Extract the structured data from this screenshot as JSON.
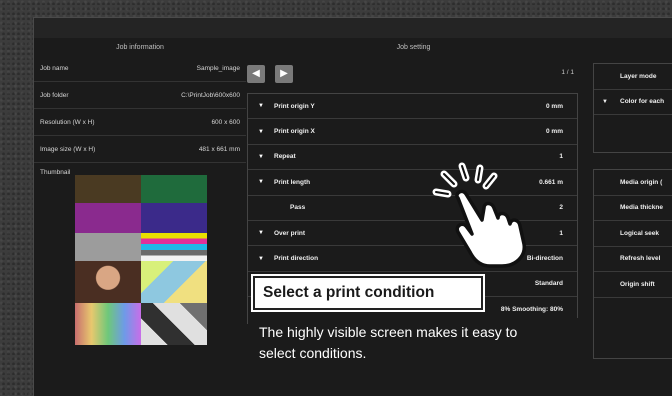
{
  "job_information": {
    "title": "Job information",
    "rows": [
      {
        "label": "Job name",
        "value": "Sample_image"
      },
      {
        "label": "Job folder",
        "value": "C:\\PrintJob\\600x600"
      },
      {
        "label": "Resolution (W x H)",
        "value": "600 x 600"
      },
      {
        "label": "Image size (W x H)",
        "value": "481 x 661 mm"
      }
    ],
    "thumbnail_label": "Thumbnail"
  },
  "job_setting": {
    "title": "Job setting",
    "prev_icon": "chevron-left-icon",
    "next_icon": "chevron-right-icon",
    "page_indicator": "1 / 1",
    "rows": [
      {
        "name": "Print origin Y",
        "value": "0 mm",
        "expandable": true
      },
      {
        "name": "Print origin X",
        "value": "0 mm",
        "expandable": true
      },
      {
        "name": "Repeat",
        "value": "1",
        "expandable": true
      },
      {
        "name": "Print length",
        "value": "0.661 m",
        "expandable": true
      },
      {
        "name": "Pass",
        "value": "2",
        "expandable": false
      },
      {
        "name": "Over print",
        "value": "1",
        "expandable": true
      },
      {
        "name": "Print direction",
        "value": "Bi-direction",
        "expandable": true
      },
      {
        "name": "",
        "value": "Standard",
        "expandable": false
      },
      {
        "name": "",
        "value": "8% Smoothing: 80%",
        "expandable": false
      }
    ]
  },
  "right_panel": {
    "group1": [
      {
        "name": "Layer mode",
        "expandable": false
      },
      {
        "name": "Color for each",
        "expandable": true
      }
    ],
    "group2": [
      {
        "name": "Media origin (",
        "expandable": false
      },
      {
        "name": "Media thickne",
        "expandable": false
      },
      {
        "name": "Logical seek",
        "expandable": false
      },
      {
        "name": "Refresh level",
        "expandable": false
      },
      {
        "name": "Origin shift",
        "expandable": false
      }
    ]
  },
  "callout": {
    "title": "Select a print condition",
    "caption_line1": "The highly visible screen makes it easy to",
    "caption_line2": "select conditions."
  },
  "colors": {
    "screen_bg": "#1b1b1b",
    "page_bg": "#3c3c3c",
    "button": "#7a7a7a"
  },
  "icons": {
    "expand": "triangle-down-icon",
    "pointer": "hand-pointer-icon"
  }
}
